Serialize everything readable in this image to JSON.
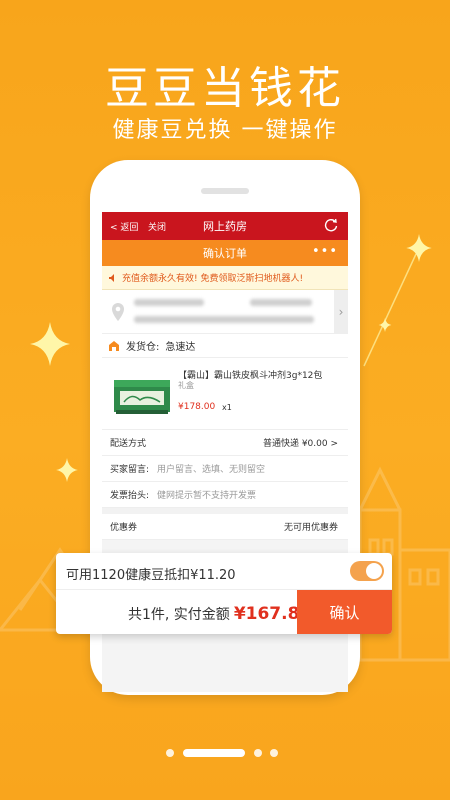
{
  "hero": {
    "title": "豆豆当钱花",
    "subtitle": "健康豆兑换 一键操作"
  },
  "app": {
    "topbar": {
      "back_label": "< 返回",
      "close_label": "关闭",
      "title": "网上药房"
    },
    "subbar": {
      "title": "确认订单",
      "more_label": "•••"
    },
    "notice": "充值余额永久有效! 免费领取泛斯扫地机器人!",
    "ship_from": {
      "label": "发货仓:",
      "value": "急速达"
    },
    "product": {
      "name": "【霸山】霸山铁皮枫斗冲剂3g*12包 ",
      "spec": "礼盒",
      "price": "¥178.00",
      "qty": "x1"
    },
    "rows": {
      "delivery": {
        "label": "配送方式",
        "value": "普通快递 ¥0.00 >"
      },
      "message": {
        "label": "买家留言:",
        "placeholder": "用户留言、选填、无则留空"
      },
      "invoice": {
        "label": "发票抬头:",
        "placeholder": "健网提示暂不支持开发票"
      },
      "coupon": {
        "label": "优惠券",
        "value": "无可用优惠券"
      }
    }
  },
  "panel": {
    "deduct_text": "可用1120健康豆抵扣¥11.20",
    "toggle_on": true,
    "summary_text": "共1件, 实付金额",
    "total": "¥167.80",
    "confirm_label": "确认"
  },
  "colors": {
    "background": "#fbad23",
    "topbar": "#c9151e",
    "subbar": "#f68b1f",
    "confirm": "#f25a2b",
    "price": "#e0301e"
  },
  "icons": [
    "sparkle-star-icon",
    "refresh-icon",
    "location-pin-icon",
    "warehouse-icon",
    "chevron-right-icon",
    "notice-icon"
  ]
}
